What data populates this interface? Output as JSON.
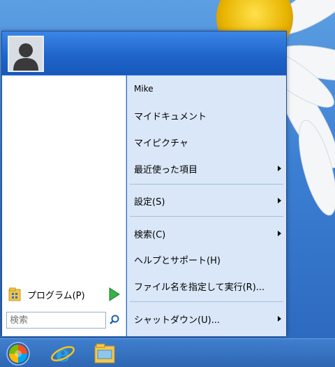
{
  "colors": {
    "menu_header": "#1e63c8",
    "right_pane": "#d9e7f8",
    "taskbar": "#2e67b3"
  },
  "user": {
    "avatar_icon": "user-silhouette-icon"
  },
  "left_pane": {
    "programs_label": "プログラム(P)",
    "programs_icon": "programs-folder-icon",
    "expand_icon": "green-play-icon",
    "search_placeholder": "検索",
    "search_icon": "magnifier-icon"
  },
  "right_pane": {
    "items": [
      {
        "label": "Mike"
      },
      {
        "label": "マイドキュメント"
      },
      {
        "label": "マイピクチャ"
      },
      {
        "label": "最近使った項目",
        "submenu": true
      },
      {
        "label": "設定(S)",
        "submenu": true
      },
      {
        "label": "検索(C)",
        "submenu": true
      },
      {
        "label": "ヘルプとサポート(H)"
      },
      {
        "label": "ファイル名を指定して実行(R)..."
      },
      {
        "label": "シャットダウン(U)...",
        "submenu": true
      }
    ]
  },
  "taskbar": {
    "start_button_icon": "start-orb-icon",
    "ie_icon": "internet-explorer-icon",
    "explorer_icon": "file-explorer-icon"
  }
}
